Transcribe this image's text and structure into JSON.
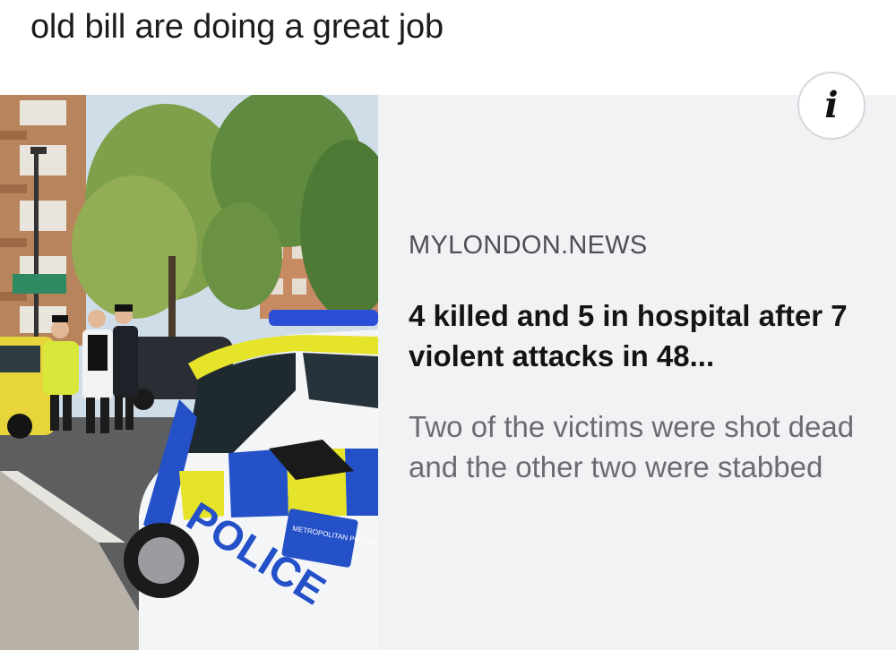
{
  "post": {
    "text": "old bill are doing a great job"
  },
  "link_card": {
    "source": "MYLONDON.NEWS",
    "headline": "4 killed and 5 in hospital after 7 violent attacks in 48...",
    "summary": "Two of the victims were shot dead and the other two were stabbed",
    "info_icon": "info-icon",
    "image": {
      "vehicle_text": "POLICE",
      "badge_text": "METROPOLITAN POLICE"
    }
  }
}
